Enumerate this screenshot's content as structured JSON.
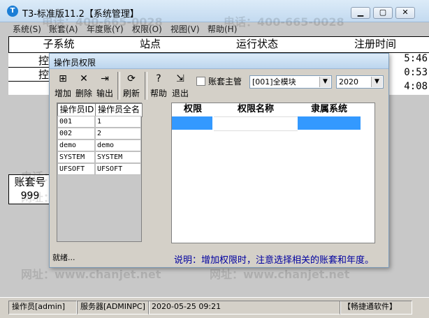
{
  "window": {
    "title": "T3-标准版11.2【系统管理】",
    "app_icon": "T3-app-icon",
    "controls": [
      "minimize",
      "maximize",
      "close"
    ]
  },
  "menu": [
    {
      "label": "系统(S)"
    },
    {
      "label": "账套(A)"
    },
    {
      "label": "年度账(Y)"
    },
    {
      "label": "权限(O)"
    },
    {
      "label": "视图(V)"
    },
    {
      "label": "帮助(H)"
    }
  ],
  "main_grid": {
    "headers": [
      "子系统",
      "站点",
      "运行状态",
      "注册时间"
    ],
    "time_fragments": [
      "5:46",
      "0:53",
      "4:08"
    ],
    "partial_cells": [
      "控",
      "控"
    ]
  },
  "account_grid": {
    "header": "账套号",
    "value": "999"
  },
  "dialog": {
    "title": "操作员权限",
    "toolbar": [
      {
        "label": "增加",
        "icon": "add-icon"
      },
      {
        "label": "删除",
        "icon": "delete-icon"
      },
      {
        "label": "输出",
        "icon": "export-icon"
      },
      {
        "label": "刷新",
        "icon": "refresh-icon"
      },
      {
        "label": "帮助",
        "icon": "help-icon"
      },
      {
        "label": "退出",
        "icon": "exit-icon"
      }
    ],
    "account_master_label": "账套主管",
    "account_master_checked": false,
    "module_select": "[001]全模块",
    "year_select": "2020",
    "operators": {
      "headers": [
        "操作员ID",
        "操作员全名"
      ],
      "rows": [
        [
          "001",
          "1"
        ],
        [
          "002",
          "2"
        ],
        [
          "demo",
          "demo"
        ],
        [
          "SYSTEM",
          "SYSTEM"
        ],
        [
          "UFSOFT",
          "UFSOFT"
        ]
      ]
    },
    "permissions": {
      "headers": [
        "权限",
        "权限名称",
        "隶属系统"
      ]
    },
    "status_text": "就绪...",
    "note": "说明：增加权限时，注意选择相关的账套和年度。",
    "selection_color": "#3399ff"
  },
  "statusbar": {
    "operator": "操作员[admin]",
    "server": "服务器[ADMINPC]",
    "datetime": "2020-05-25 09:21",
    "brand": "【畅捷通软件】"
  },
  "watermark": {
    "phone": "电话：400-665-0028",
    "site": "网址：www.chanjet.net"
  }
}
